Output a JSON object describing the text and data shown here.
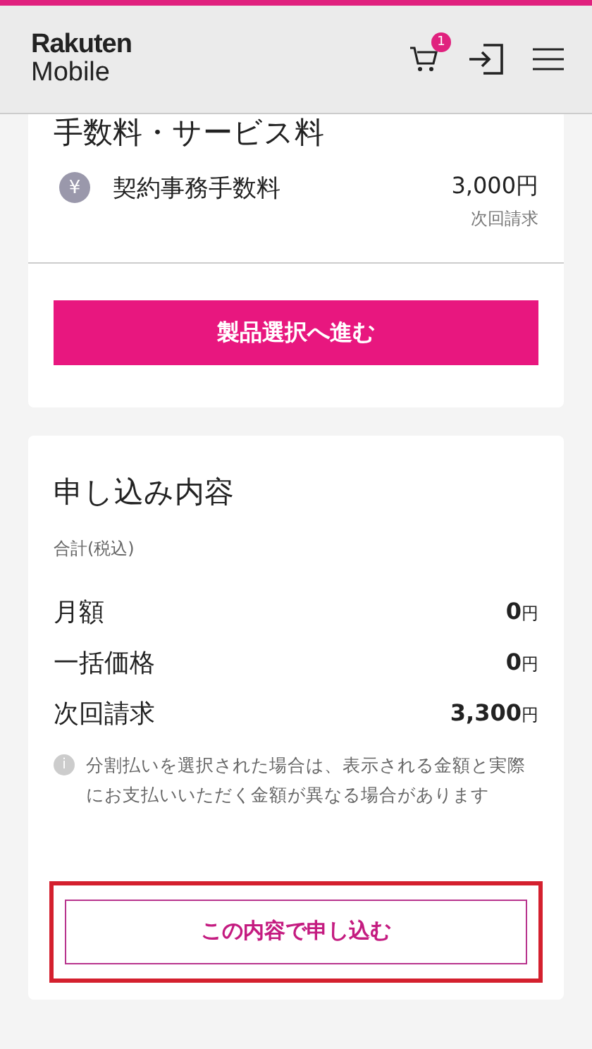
{
  "header": {
    "logo_top": "Rakuten",
    "logo_bottom": "Mobile",
    "cart_count": "1"
  },
  "fees": {
    "title": "手数料・サービス料",
    "items": [
      {
        "name": "契約事務手数料",
        "icon": "¥",
        "price": "3,000円",
        "note": "次回請求"
      }
    ],
    "button": "製品選択へ進む"
  },
  "summary": {
    "title": "申し込み内容",
    "subtitle": "合計(税込)",
    "rows": [
      {
        "label": "月額",
        "amount": "0",
        "unit": "円"
      },
      {
        "label": "一括価格",
        "amount": "0",
        "unit": "円"
      },
      {
        "label": "次回請求",
        "amount": "3,300",
        "unit": "円"
      }
    ],
    "note_icon": "i",
    "note": "分割払いを選択された場合は、表示される金額と実際にお支払いいただく金額が異なる場合があります",
    "button": {
      "label": "この内容で申し込む",
      "highlighted": true
    }
  }
}
